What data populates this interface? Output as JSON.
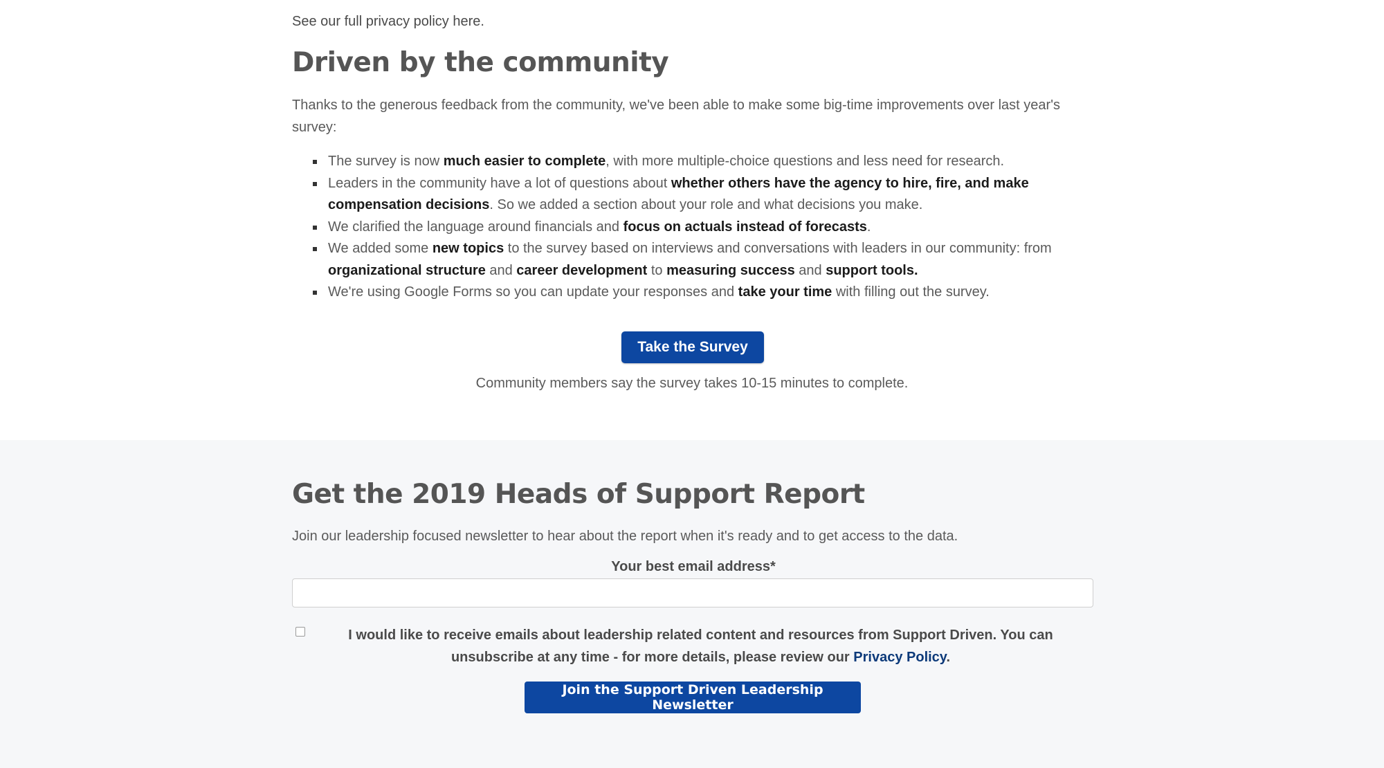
{
  "privacy": {
    "text": "See our full privacy policy here."
  },
  "community": {
    "heading": "Driven by the community",
    "intro": "Thanks to the generous feedback from the community, we've been able to make some big-time improvements over last year's survey:",
    "items": [
      {
        "parts": [
          {
            "t": "The survey is now ",
            "b": false
          },
          {
            "t": "much easier to complete",
            "b": true
          },
          {
            "t": ", with more multiple-choice questions and less need for research.",
            "b": false
          }
        ]
      },
      {
        "parts": [
          {
            "t": "Leaders in the community have a lot of questions about ",
            "b": false
          },
          {
            "t": "whether others have the agency to hire, fire, and make compensation decisions",
            "b": true
          },
          {
            "t": ". So we added a section about your role and what decisions you make.",
            "b": false
          }
        ]
      },
      {
        "parts": [
          {
            "t": "We clarified the language around financials and ",
            "b": false
          },
          {
            "t": "focus on actuals instead of forecasts",
            "b": true
          },
          {
            "t": ".",
            "b": false
          }
        ]
      },
      {
        "parts": [
          {
            "t": "We added some ",
            "b": false
          },
          {
            "t": "new topics",
            "b": true
          },
          {
            "t": " to the survey based on interviews and conversations with leaders in our community: from ",
            "b": false
          },
          {
            "t": "organizational structure",
            "b": true
          },
          {
            "t": " and ",
            "b": false
          },
          {
            "t": "career development",
            "b": true
          },
          {
            "t": " to ",
            "b": false
          },
          {
            "t": "measuring success",
            "b": true
          },
          {
            "t": " and ",
            "b": false
          },
          {
            "t": "support tools.",
            "b": true
          }
        ]
      },
      {
        "parts": [
          {
            "t": "We're using Google Forms so you can update your responses and ",
            "b": false
          },
          {
            "t": "take your time",
            "b": true
          },
          {
            "t": " with filling out the survey.",
            "b": false
          }
        ]
      }
    ],
    "button_label": "Take the Survey",
    "note": "Community members say the survey takes 10-15 minutes to complete."
  },
  "report": {
    "heading": "Get the 2019 Heads of Support Report",
    "intro": "Join our leadership focused newsletter to hear about the report when it's ready and to get access to the data.",
    "email_label": "Your best email address*",
    "email_value": "",
    "consent_text": "I would like to receive emails about leadership related content and resources from Support Driven. You can unsubscribe at any time - for more details, please review our ",
    "consent_link": "Privacy Policy",
    "consent_end": ".",
    "button_label": "Join the Support Driven Leadership Newsletter"
  },
  "colors": {
    "accent": "#0d47a1",
    "section_bg": "#f6f7f9"
  }
}
